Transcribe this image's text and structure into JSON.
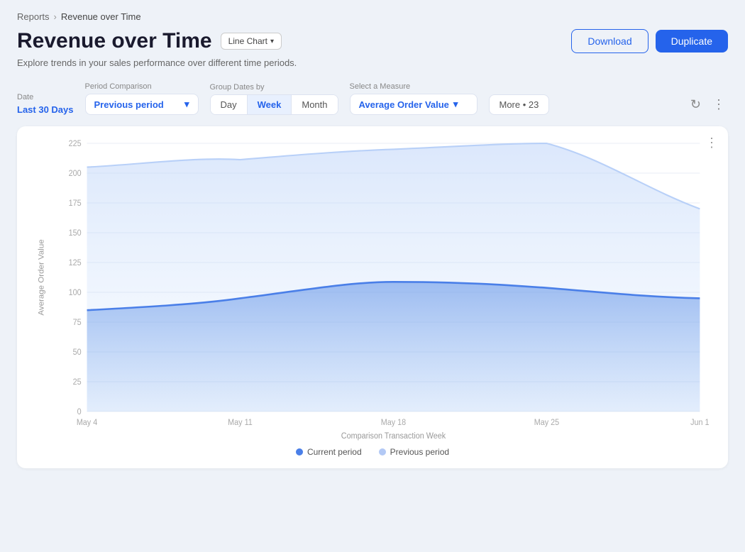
{
  "breadcrumb": {
    "parent": "Reports",
    "separator": "›",
    "current": "Revenue over Time"
  },
  "header": {
    "title": "Revenue over Time",
    "chart_type_btn": "Line Chart",
    "subtitle": "Explore trends in your sales performance over different time periods.",
    "download_btn": "Download",
    "duplicate_btn": "Duplicate"
  },
  "filters": {
    "date_label": "Date",
    "date_value": "Last 30 Days",
    "period_label": "Period Comparison",
    "period_value": "Previous period",
    "group_label": "Group Dates by",
    "group_options": [
      "Day",
      "Week",
      "Month"
    ],
    "group_active": "Week",
    "measure_label": "Select a Measure",
    "measure_value": "Average Order Value",
    "more_label": "More • 23"
  },
  "chart": {
    "y_axis_label": "Average Order Value",
    "x_axis_label": "Comparison Transaction Week",
    "y_ticks": [
      "225",
      "200",
      "175",
      "150",
      "125",
      "100",
      "75",
      "50",
      "25",
      "0"
    ],
    "x_ticks": [
      "May 4",
      "May 11",
      "May 18",
      "May 25",
      "Jun 1"
    ],
    "legend": {
      "current_label": "Current period",
      "previous_label": "Previous period"
    }
  },
  "icons": {
    "chevron": "▾",
    "refresh": "↻",
    "three_dots": "⋮",
    "chart_chevron": "▾"
  }
}
